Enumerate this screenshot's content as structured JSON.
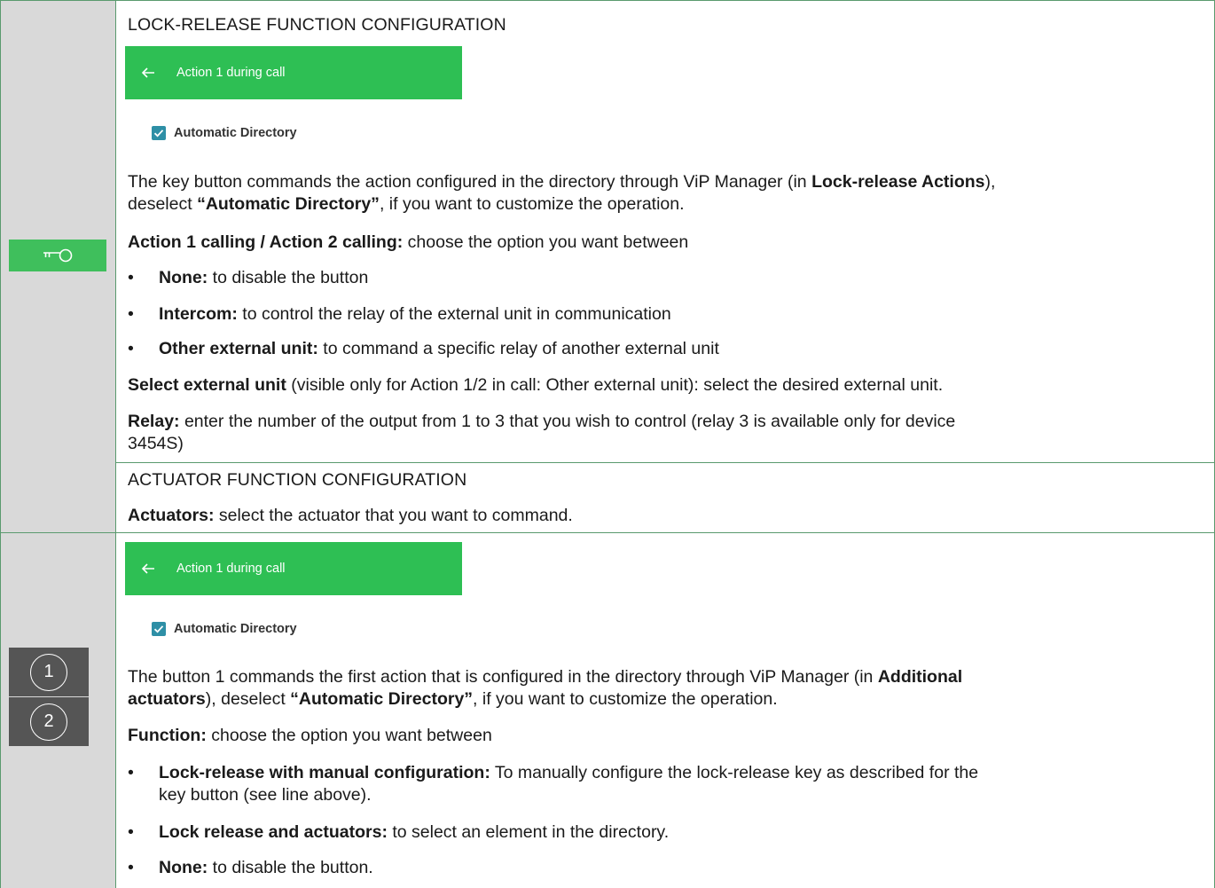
{
  "section1": {
    "heading": "LOCK-RELEASE FUNCTION CONFIGURATION",
    "bar_label": "Action 1 during call",
    "checkbox_label": "Automatic Directory",
    "intro": {
      "t1": "The key button commands the action configured in the directory through ViP Manager (in ",
      "b1": "Lock-release Actions",
      "t2": "),",
      "t3": "deselect ",
      "b2": "“Automatic Directory”",
      "t4": ", if you want to customize the operation."
    },
    "choose": {
      "b": "Action 1 calling / Action 2 calling:",
      "t": " choose the option you want between"
    },
    "bullets": [
      {
        "b": "None:",
        "t": " to disable the button"
      },
      {
        "b": "Intercom:",
        "t": " to control the relay of the external unit in communication"
      },
      {
        "b": "Other external unit:",
        "t": " to command a specific relay of another external unit"
      }
    ],
    "select_unit": {
      "b": "Select external unit",
      "t": " (visible only for Action 1/2 in call: Other external unit): select the desired external unit."
    },
    "relay": {
      "b": "Relay:",
      "t1": " enter the number of the output from 1 to 3 that you wish to control (relay 3 is available only for device",
      "t2": "3454S)"
    },
    "actuator_heading": "ACTUATOR FUNCTION CONFIGURATION",
    "actuators": {
      "b": "Actuators:",
      "t": " select the actuator that you want to command."
    }
  },
  "section2": {
    "bar_label": "Action 1 during call",
    "checkbox_label": "Automatic Directory",
    "button_numbers": [
      "1",
      "2"
    ],
    "intro": {
      "t1": "The button 1 commands the first action that is configured in the directory through ViP Manager (in ",
      "b1": "Additional",
      "b2": "actuators",
      "t2": "), deselect ",
      "b3": "“Automatic Directory”",
      "t3": ", if you want to customize the operation."
    },
    "function": {
      "b": "Function:",
      "t": " choose the option you want between"
    },
    "bullets": [
      {
        "b": "Lock-release with manual configuration:",
        "t1": " To manually configure the lock-release key as described for the",
        "t2": "key button (see line above)."
      },
      {
        "b": "Lock release and actuators:",
        "t1": " to select an element in the directory."
      },
      {
        "b": "None:",
        "t1": " to disable the button."
      }
    ]
  },
  "icons": [
    "key-icon",
    "back-arrow-icon",
    "checkbox-checked-icon"
  ],
  "colors": {
    "accent_green": "#2ebf54",
    "border_green": "#5a9a6e",
    "sidebar_gray": "#d9d9d9",
    "number_button": "#555555"
  }
}
